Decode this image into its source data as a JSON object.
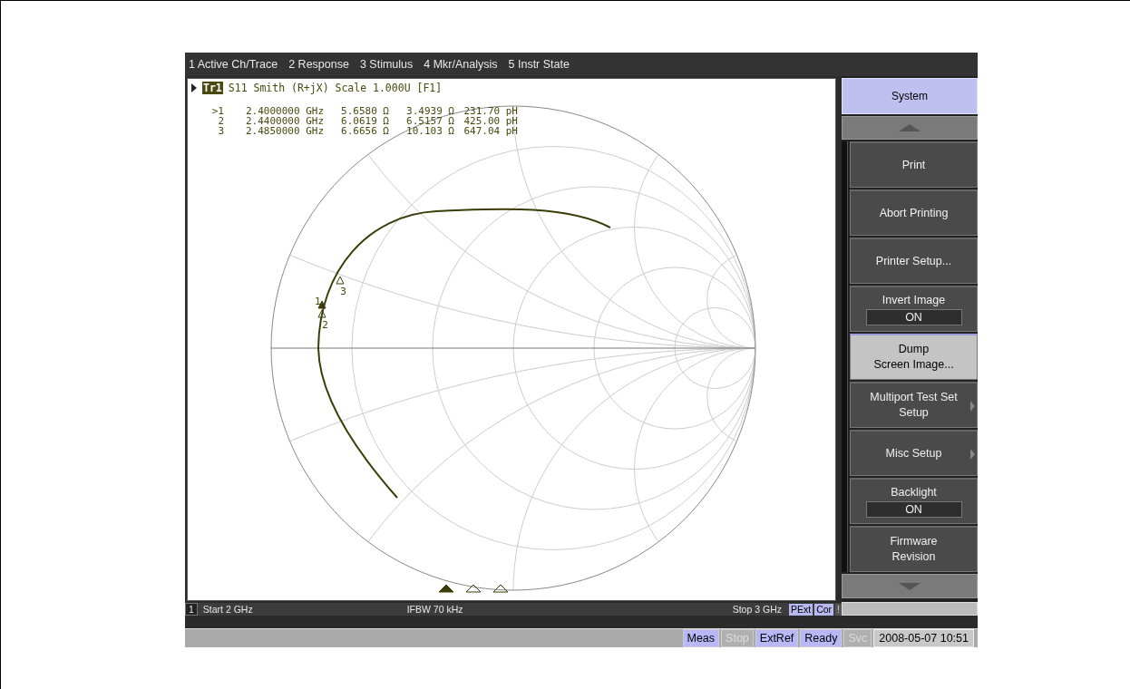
{
  "menu": [
    {
      "label": "1 Active Ch/Trace"
    },
    {
      "label": "2 Response"
    },
    {
      "label": "3 Stimulus"
    },
    {
      "label": "4 Mkr/Analysis"
    },
    {
      "label": "5 Instr State"
    }
  ],
  "trace": {
    "label": "Tr1",
    "header": "S11 Smith (R+jX) Scale 1.000U [F1]"
  },
  "markers": [
    {
      "id": ">1",
      "frequency": "2.4000000 GHz",
      "resistance": "5.6580 Ω",
      "reactance": "3.4939 Ω",
      "inductance": "231.70 pH",
      "chart_label": "1",
      "active": true
    },
    {
      "id": "2",
      "frequency": "2.4400000 GHz",
      "resistance": "6.0619 Ω",
      "reactance": "6.5157 Ω",
      "inductance": "425.00 pH",
      "chart_label": "2",
      "active": false
    },
    {
      "id": "3",
      "frequency": "2.4850000 GHz",
      "resistance": "6.6656 Ω",
      "reactance": "10.103 Ω",
      "inductance": "647.04 pH",
      "chart_label": "3",
      "active": false
    }
  ],
  "softkeys": {
    "title": "System",
    "items": [
      {
        "kind": "button",
        "label": "Print",
        "selected": false
      },
      {
        "kind": "button",
        "label": "Abort Printing",
        "selected": false
      },
      {
        "kind": "button",
        "label": "Printer Setup...",
        "selected": false
      },
      {
        "kind": "toggle",
        "label": "Invert Image",
        "value": "ON",
        "selected": false
      },
      {
        "kind": "button",
        "label": "Dump\nScreen Image...",
        "selected": true
      },
      {
        "kind": "submenu",
        "label": "Multiport Test Set\nSetup",
        "selected": false
      },
      {
        "kind": "submenu",
        "label": "Misc Setup",
        "selected": false
      },
      {
        "kind": "toggle",
        "label": "Backlight",
        "value": "ON",
        "selected": false
      },
      {
        "kind": "button",
        "label": "Firmware\nRevision",
        "selected": false
      }
    ]
  },
  "channel_bar": {
    "channel": "1",
    "start": "Start 2 GHz",
    "ifbw": "IFBW 70 kHz",
    "stop": "Stop 3 GHz",
    "flags": [
      {
        "label": "PExt",
        "on": true
      },
      {
        "label": "Cor",
        "on": true
      },
      {
        "label": "!",
        "on": false
      }
    ]
  },
  "status_bar": {
    "items": [
      {
        "label": "Meas",
        "on": true
      },
      {
        "label": "Stop",
        "on": false
      },
      {
        "label": "ExtRef",
        "on": true
      },
      {
        "label": "Ready",
        "on": true
      },
      {
        "label": "Svc",
        "on": false
      }
    ],
    "datetime": "2008-05-07 10:51"
  }
}
